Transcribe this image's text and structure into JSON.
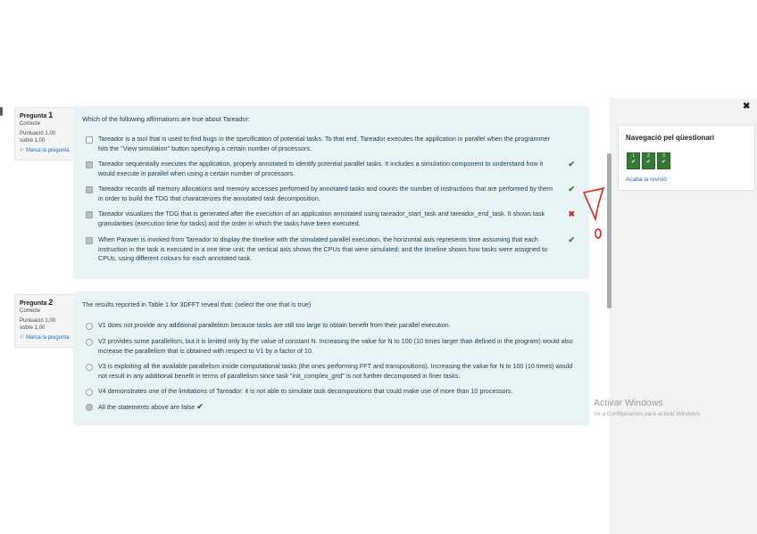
{
  "questions": [
    {
      "number_label": "Pregunta",
      "number": "1",
      "status": "Correcte",
      "score": "Puntuació 1,00",
      "out_of": "sobre 1,00",
      "flag": "Marca la pregunta",
      "text": "Which of the following affirmations are true about Tareador:",
      "options": [
        {
          "text": "Tareador is a tool that is used to find bugs in the specification of potential tasks. To that end, Tareador executes the application in parallel when the programmer hits the \"View simulation\" button specifying a certain number of processors.",
          "checked": false,
          "mark": ""
        },
        {
          "text": "Tareador sequentially executes the application, properly annotated to identify potential parallel tasks. It includes a simulation component to understand how it would execute in parallel when using a certain number of processors.",
          "checked": true,
          "mark": "✔"
        },
        {
          "text": "Tareador records all memory allocations and memory accesses performed by annotated tasks and counts the number of instructions that are performed by them in order to build the TDG that characterizes the annotated task decomposition.",
          "checked": true,
          "mark": "✔"
        },
        {
          "text": "Tareador visualizes the TDG that is generated after the execution of an application annotated using tareador_start_task and tareador_end_task. It shows task granularities (execution time for tasks) and the order in which the tasks have been executed.",
          "checked": true,
          "mark": "✖"
        },
        {
          "text": "When Paraver is invoked from Tareador to display the timeline with the simulated parallel execution, the horizontal axis represents time assuming that each instruction in the task is executed in a one time unit; the vertical axis shows the CPUs that were simulated; and the timeline shows how tasks were assigned to CPUs, using different colours for each annotated task.",
          "checked": true,
          "mark": "✔"
        }
      ]
    },
    {
      "number_label": "Pregunta",
      "number": "2",
      "status": "Correcte",
      "score": "Puntuació 1,00",
      "out_of": "sobre 1,00",
      "flag": "Marca la pregunta",
      "text": "The results reported in Table 1 for 3DFFT reveal that: (select the one that is true)",
      "options": [
        {
          "text": "V1 does not provide any additional parallelism because tasks are still too large to obtain benefit from their parallel execution.",
          "checked": false,
          "mark": ""
        },
        {
          "text": "V2 provides some parallelism, but it is limited only by the value of constant N. Increasing the value for N to 100 (10 times larger than defined in the program) would also increase the parallelism that is obtained with respect to V1 by a factor of 10.",
          "checked": false,
          "mark": ""
        },
        {
          "text": "V3 is exploiting all the available parallelism inside computational tasks (the ones performing FFT and transpositions). Increasing the value for N to 100 (10 times) would not result in any additional benefit in terms of parallelism since task \"init_complex_grid\" is not further decomposed in finer tasks.",
          "checked": false,
          "mark": ""
        },
        {
          "text": "V4 demonstrates one of the limitations of Tareador: it is not able to simulate task decompositions that could make use of more than 10 processors.",
          "checked": false,
          "mark": ""
        },
        {
          "text": "All the statements above are false",
          "checked": true,
          "mark": "✔"
        }
      ]
    }
  ],
  "nav": {
    "close": "✖",
    "title": "Navegació pel qüestionari",
    "buttons": [
      {
        "n": "1",
        "c": "✔"
      },
      {
        "n": "2",
        "c": "✔"
      },
      {
        "n": "3",
        "c": "✔"
      }
    ],
    "finish": "Acaba la revisió"
  },
  "watermark": {
    "line1": "Activar Windows",
    "line2": "Ve a Configuración para activar Windows."
  },
  "colors": {
    "correct": "#357a32",
    "incorrect": "#ca3120",
    "question_bg": "#e7f3f5",
    "link": "#0f6cbf"
  }
}
